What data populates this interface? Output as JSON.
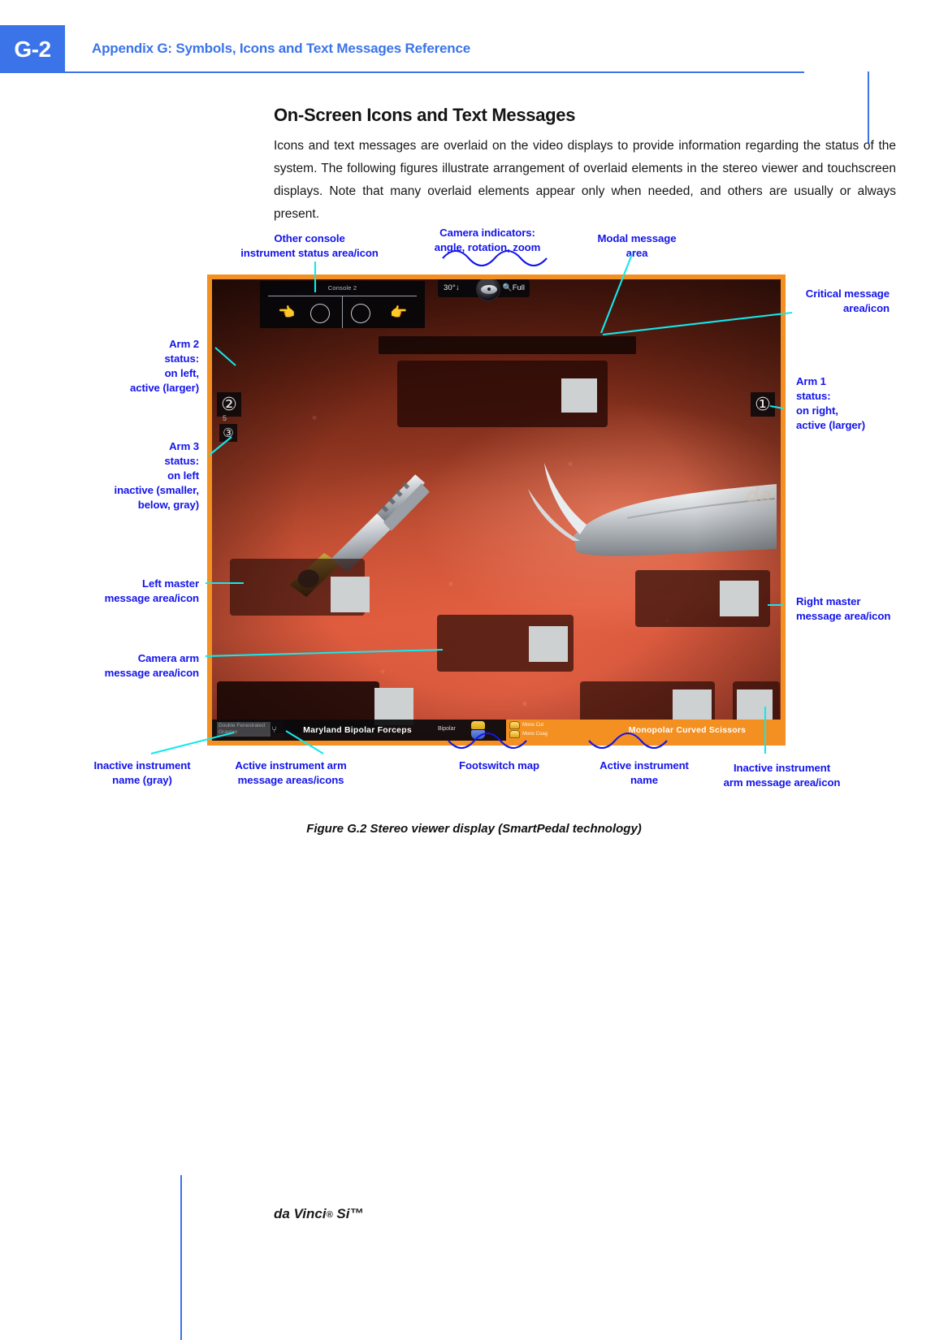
{
  "page": {
    "badge": "G-2",
    "running_head": "Appendix G: Symbols, Icons and Text Messages Reference",
    "footer": "da Vinci",
    "footer_reg": "®",
    "footer_model": " Si™",
    "accent_blue": "#3b74e8",
    "callout_blue": "#1414ec",
    "leader_cyan": "#13e8ec",
    "frame_orange": "#f39021"
  },
  "section": {
    "title": "On-Screen Icons and Text Messages",
    "paragraph": "Icons and text messages are overlaid on the video displays to provide information regarding the status of the system. The following figures illustrate arrangement of overlaid elements in the stereo viewer and touchscreen displays. Note that many overlaid elements appear only when needed, and others are usually or always present."
  },
  "figure": {
    "caption": "Figure G.2 Stereo viewer display (SmartPedal technology)"
  },
  "callouts": {
    "other_console": "Other console\ninstrument status area/icon",
    "camera_indicators": "Camera indicators:\nangle, rotation, zoom",
    "modal_message": "Modal message\narea",
    "critical_message": "Critical message\narea/icon",
    "arm1_status": "Arm 1\nstatus:\non right,\nactive (larger)",
    "arm2_status": "Arm 2\nstatus:\non left,\nactive (larger)",
    "arm3_status": "Arm 3\nstatus:\non left\ninactive (smaller,\nbelow, gray)",
    "left_master": "Left master\nmessage area/icon",
    "camera_arm": "Camera arm\nmessage area/icon",
    "right_master": "Right master\nmessage area/icon",
    "inactive_instrument_name": "Inactive instrument\nname (gray)",
    "active_instrument_arm": "Active instrument arm\nmessage areas/icons",
    "footswitch_map": "Footswitch map",
    "active_instrument_name": "Active instrument\nname",
    "inactive_instrument_arm": "Inactive instrument\narm message area/icon"
  },
  "viewer": {
    "other_console": {
      "title": "Console 2",
      "hand_left_icon": "hand-left-icon",
      "hand_right_icon": "hand-right-icon",
      "ring_left_icon": "instrument-ring-left-icon",
      "ring_right_icon": "instrument-ring-right-icon"
    },
    "camera": {
      "angle": "30°↓",
      "zoom_icon": "magnifier-icon",
      "zoom": "Full",
      "rotation_icon": "camera-rotation-dial-icon"
    },
    "arms": {
      "arm1_badge": "①",
      "arm2_badge": "②",
      "arm3_badge": "③",
      "arm3_sublabel": "5"
    },
    "bottom_bar": {
      "inactive_instrument_name": "Double Fenestrated Grasper",
      "inactive_instrument_glyph": "⑂",
      "active_instrument_name": "Maryland Bipolar Forceps",
      "bipolar_label": "Bipolar",
      "footswitch": [
        {
          "label": "Mono Cut",
          "pedal_icon": "footpedal-icon"
        },
        {
          "label": "Mono Coag",
          "pedal_icon": "footpedal-icon"
        }
      ],
      "monopolar_instrument_name": "Monopolar Curved Scissors"
    },
    "watermark": "da"
  }
}
